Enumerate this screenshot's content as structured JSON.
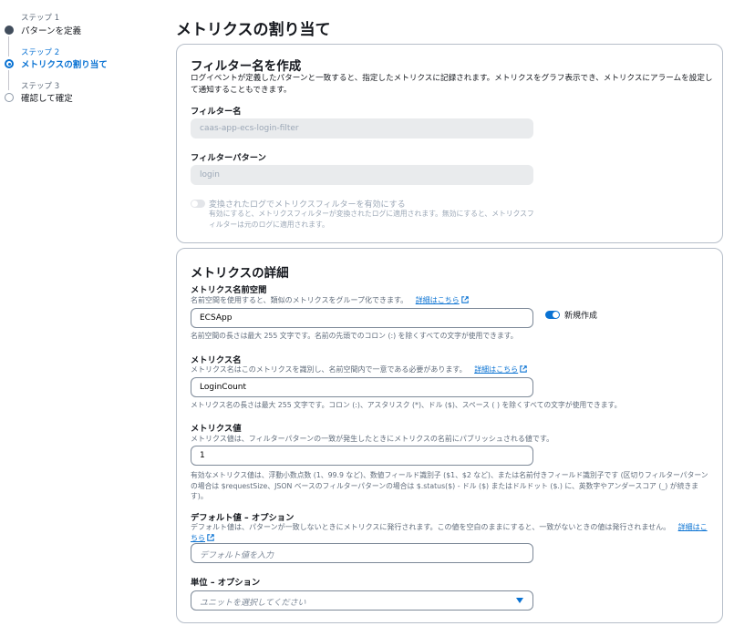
{
  "steps": [
    {
      "sub": "ステップ 1",
      "name": "パターンを定義",
      "state": "done"
    },
    {
      "sub": "ステップ 2",
      "name": "メトリクスの割り当て",
      "state": "current"
    },
    {
      "sub": "ステップ 3",
      "name": "確認して確定",
      "state": "pending"
    }
  ],
  "page_title": "メトリクスの割り当て",
  "filter_section": {
    "title": "フィルター名を作成",
    "description": "ログイベントが定義したパターンと一致すると、指定したメトリクスに記録されます。メトリクスをグラフ表示でき、メトリクスにアラームを設定して通知することもできます。",
    "filter_name_label": "フィルター名",
    "filter_name_value": "caas-app-ecs-login-filter",
    "filter_pattern_label": "フィルターパターン",
    "filter_pattern_value": "login",
    "transform_toggle_label": "変換されたログでメトリクスフィルターを有効にする",
    "transform_toggle_desc": "有効にすると、メトリクスフィルターが変換されたログに適用されます。無効にすると、メトリクスフィルターは元のログに適用されます。",
    "transform_toggle_on": false
  },
  "metrics_section": {
    "title": "メトリクスの詳細",
    "namespace_label": "メトリクス名前空間",
    "namespace_desc": "名前空間を使用すると、類似のメトリクスをグループ化できます。",
    "learn_more": "詳細はこちら",
    "namespace_value": "ECSApp",
    "new_create_label": "新規作成",
    "new_create_on": true,
    "namespace_constraint": "名前空間の長さは最大 255 文字です。名前の先頭でのコロン (:) を除くすべての文字が使用できます。",
    "metric_name_label": "メトリクス名",
    "metric_name_desc": "メトリクス名はこのメトリクスを識別し、名前空間内で一意である必要があります。",
    "metric_name_value": "LoginCount",
    "metric_name_constraint": "メトリクス名の長さは最大 255 文字です。コロン (:)、アスタリスク (*)、ドル ($)、スペース ( ) を除くすべての文字が使用できます。",
    "metric_value_label": "メトリクス値",
    "metric_value_desc": "メトリクス値は、フィルターパターンの一致が発生したときにメトリクスの名前にパブリッシュされる値です。",
    "metric_value_value": "1",
    "metric_value_constraint": "有効なメトリクス値は、浮動小数点数 (1、99.9 など)、数値フィールド識別子 ($1、$2 など)、または名前付きフィールド識別子です (区切りフィルターパターンの場合は $requestSize、JSON ベースのフィルターパターンの場合は $.status($) - ドル ($) またはドルドット ($.) に、英数字やアンダースコア (_) が続きます)。",
    "default_label": "デフォルト値 – オプション",
    "default_desc": "デフォルト値は、パターンが一致しないときにメトリクスに発行されます。この値を空白のままにすると、一致がないときの値は発行されません。",
    "default_learn_more_1": "詳細はこ",
    "default_learn_more_2": "ちら",
    "default_placeholder": "デフォルト値を入力",
    "unit_label": "単位 – オプション",
    "unit_placeholder": "ユニットを選択してください"
  }
}
